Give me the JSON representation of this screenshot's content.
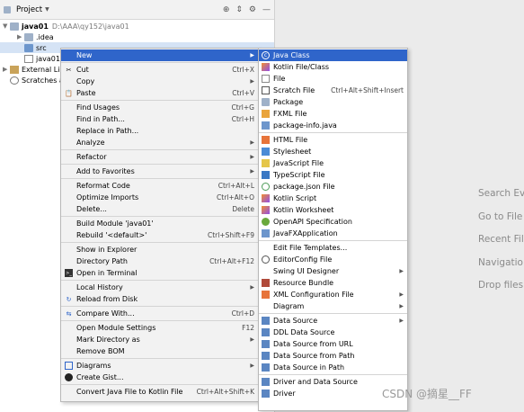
{
  "panel": {
    "title": "Project",
    "tree": [
      {
        "label": "java01",
        "path": "D:\\AAA\\qy152\\java01"
      },
      {
        "label": ".idea"
      },
      {
        "label": "src"
      },
      {
        "label": "java01.i"
      },
      {
        "label": "External Li"
      },
      {
        "label": "Scratches a"
      }
    ]
  },
  "hints": [
    "Search Ev",
    "Go to File",
    "Recent Fil",
    "Navigatio",
    "Drop files"
  ],
  "context_menu": [
    {
      "label": "New",
      "caret": true
    },
    {
      "label": "Cut",
      "shortcut": "Ctrl+X"
    },
    {
      "label": "Copy",
      "caret": true
    },
    {
      "label": "Paste",
      "shortcut": "Ctrl+V"
    },
    {
      "label": "Find Usages",
      "shortcut": "Ctrl+G"
    },
    {
      "label": "Find in Path...",
      "shortcut": "Ctrl+H"
    },
    {
      "label": "Replace in Path..."
    },
    {
      "label": "Analyze",
      "caret": true
    },
    {
      "label": "Refactor",
      "caret": true
    },
    {
      "label": "Add to Favorites",
      "caret": true
    },
    {
      "label": "Reformat Code",
      "shortcut": "Ctrl+Alt+L"
    },
    {
      "label": "Optimize Imports",
      "shortcut": "Ctrl+Alt+O"
    },
    {
      "label": "Delete...",
      "shortcut": "Delete"
    },
    {
      "label": "Build Module 'java01'"
    },
    {
      "label": "Rebuild '<default>'",
      "shortcut": "Ctrl+Shift+F9"
    },
    {
      "label": "Show in Explorer"
    },
    {
      "label": "Directory Path",
      "shortcut": "Ctrl+Alt+F12"
    },
    {
      "label": "Open in Terminal"
    },
    {
      "label": "Local History",
      "caret": true
    },
    {
      "label": "Reload from Disk"
    },
    {
      "label": "Compare With...",
      "shortcut": "Ctrl+D"
    },
    {
      "label": "Open Module Settings",
      "shortcut": "F12"
    },
    {
      "label": "Mark Directory as",
      "caret": true
    },
    {
      "label": "Remove BOM"
    },
    {
      "label": "Diagrams",
      "caret": true
    },
    {
      "label": "Create Gist..."
    },
    {
      "label": "Convert Java File to Kotlin File",
      "shortcut": "Ctrl+Alt+Shift+K"
    }
  ],
  "new_submenu": [
    {
      "label": "Java Class"
    },
    {
      "label": "Kotlin File/Class"
    },
    {
      "label": "File"
    },
    {
      "label": "Scratch File",
      "shortcut": "Ctrl+Alt+Shift+Insert"
    },
    {
      "label": "Package"
    },
    {
      "label": "FXML File"
    },
    {
      "label": "package-info.java"
    },
    {
      "label": "HTML File"
    },
    {
      "label": "Stylesheet"
    },
    {
      "label": "JavaScript File"
    },
    {
      "label": "TypeScript File"
    },
    {
      "label": "package.json File"
    },
    {
      "label": "Kotlin Script"
    },
    {
      "label": "Kotlin Worksheet"
    },
    {
      "label": "OpenAPI Specification"
    },
    {
      "label": "JavaFXApplication"
    },
    {
      "label": "Edit File Templates..."
    },
    {
      "label": "EditorConfig File"
    },
    {
      "label": "Swing UI Designer",
      "caret": true
    },
    {
      "label": "Resource Bundle"
    },
    {
      "label": "XML Configuration File",
      "caret": true
    },
    {
      "label": "Diagram",
      "caret": true
    },
    {
      "label": "Data Source",
      "caret": true
    },
    {
      "label": "DDL Data Source"
    },
    {
      "label": "Data Source from URL"
    },
    {
      "label": "Data Source from Path"
    },
    {
      "label": "Data Source in Path"
    },
    {
      "label": "Driver and Data Source"
    },
    {
      "label": "Driver"
    }
  ],
  "watermark": "CSDN @摘星__FF"
}
